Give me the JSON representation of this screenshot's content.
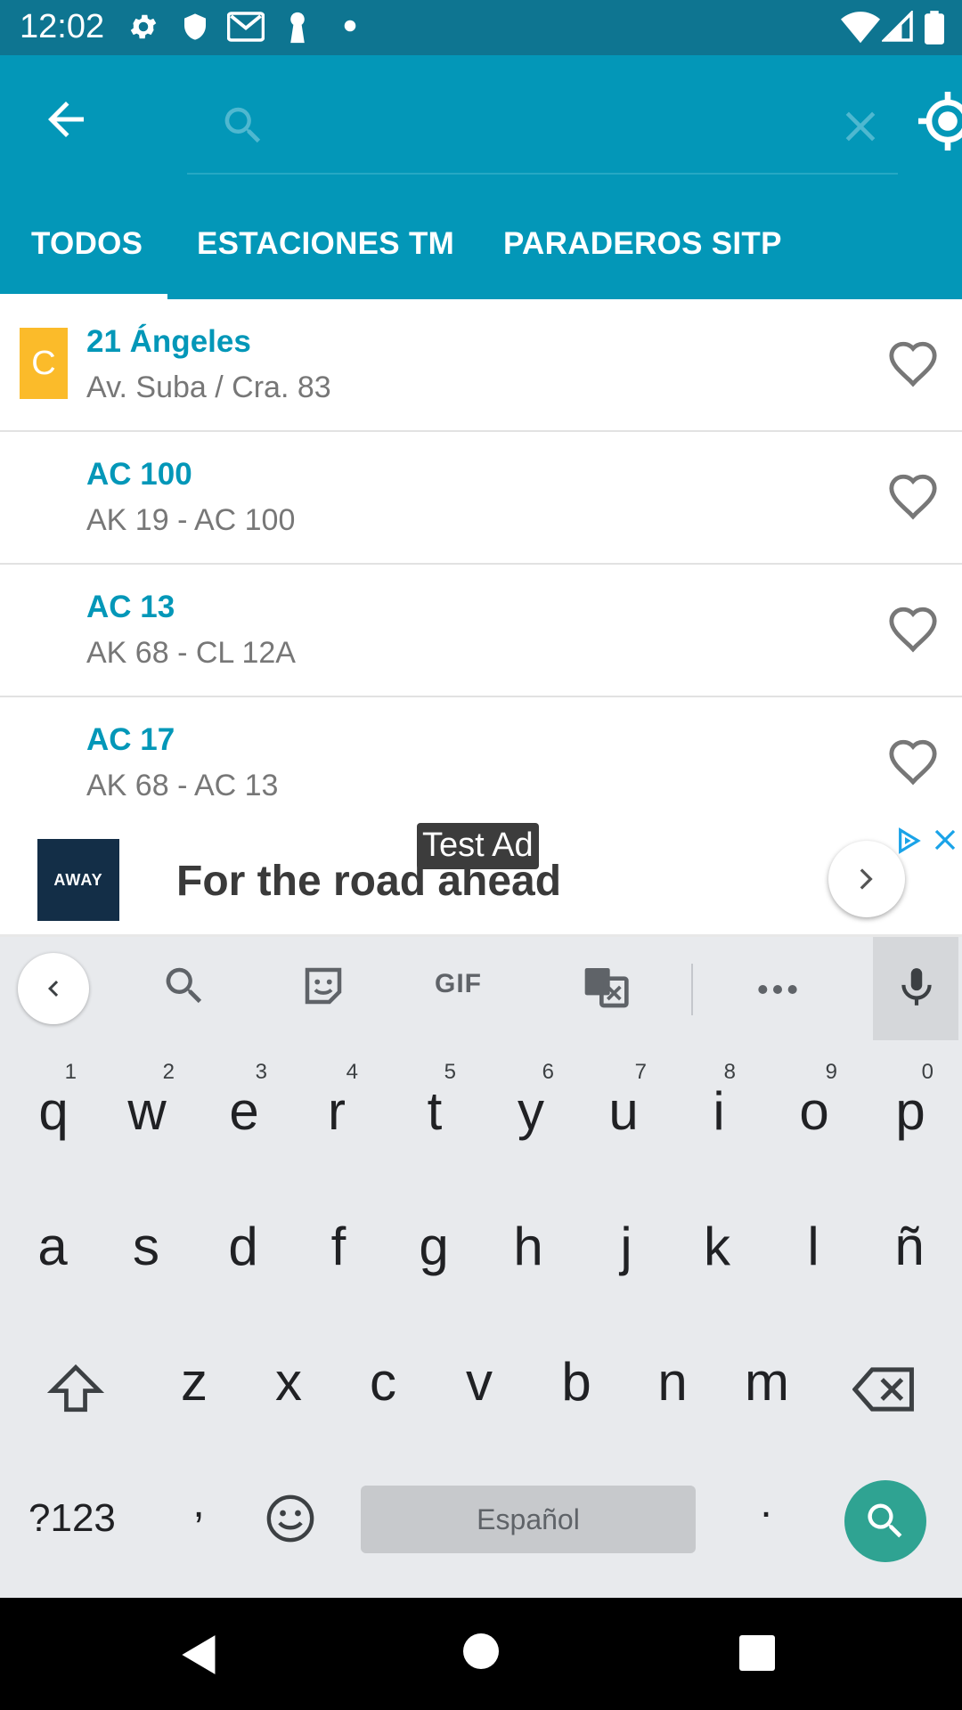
{
  "status_bar": {
    "time": "12:02",
    "icons": [
      "gear-icon",
      "shield-icon",
      "gmail-icon",
      "keyhole-icon",
      "dot-icon",
      "wifi-icon",
      "signal-icon",
      "battery-icon"
    ]
  },
  "app_bar": {
    "search_placeholder": "",
    "tabs": [
      {
        "label": "TODOS",
        "selected": true
      },
      {
        "label": "ESTACIONES TM",
        "selected": false
      },
      {
        "label": "PARADEROS SITP",
        "selected": false
      }
    ]
  },
  "stops": [
    {
      "badge": "C",
      "badge_color": "#FBBB2A",
      "name": "21 Ángeles",
      "address": "Av. Suba / Cra. 83"
    },
    {
      "badge": "",
      "name": "AC 100",
      "address": "AK 19 - AC 100"
    },
    {
      "badge": "",
      "name": "AC 13",
      "address": "AK 68 - CL 12A"
    },
    {
      "badge": "",
      "name": "AC 17",
      "address": "AK 68 - AC 13"
    }
  ],
  "ad": {
    "label": "Test Ad",
    "logo_text": "AWAY",
    "headline": "For the road ahead"
  },
  "keyboard": {
    "toolbar_gif": "GIF",
    "row1": [
      {
        "ch": "q",
        "hint": "1"
      },
      {
        "ch": "w",
        "hint": "2"
      },
      {
        "ch": "e",
        "hint": "3"
      },
      {
        "ch": "r",
        "hint": "4"
      },
      {
        "ch": "t",
        "hint": "5"
      },
      {
        "ch": "y",
        "hint": "6"
      },
      {
        "ch": "u",
        "hint": "7"
      },
      {
        "ch": "i",
        "hint": "8"
      },
      {
        "ch": "o",
        "hint": "9"
      },
      {
        "ch": "p",
        "hint": "0"
      }
    ],
    "row2": [
      "a",
      "s",
      "d",
      "f",
      "g",
      "h",
      "j",
      "k",
      "l",
      "ñ"
    ],
    "row3": [
      "z",
      "x",
      "c",
      "v",
      "b",
      "n",
      "m"
    ],
    "symbols_label": "?123",
    "comma": ",",
    "space_label": "Español",
    "period": "."
  },
  "colors": {
    "status_bar": "#0E7591",
    "app_bar": "#0397B8",
    "accent": "#0397B8",
    "search_key": "#2FA392"
  }
}
